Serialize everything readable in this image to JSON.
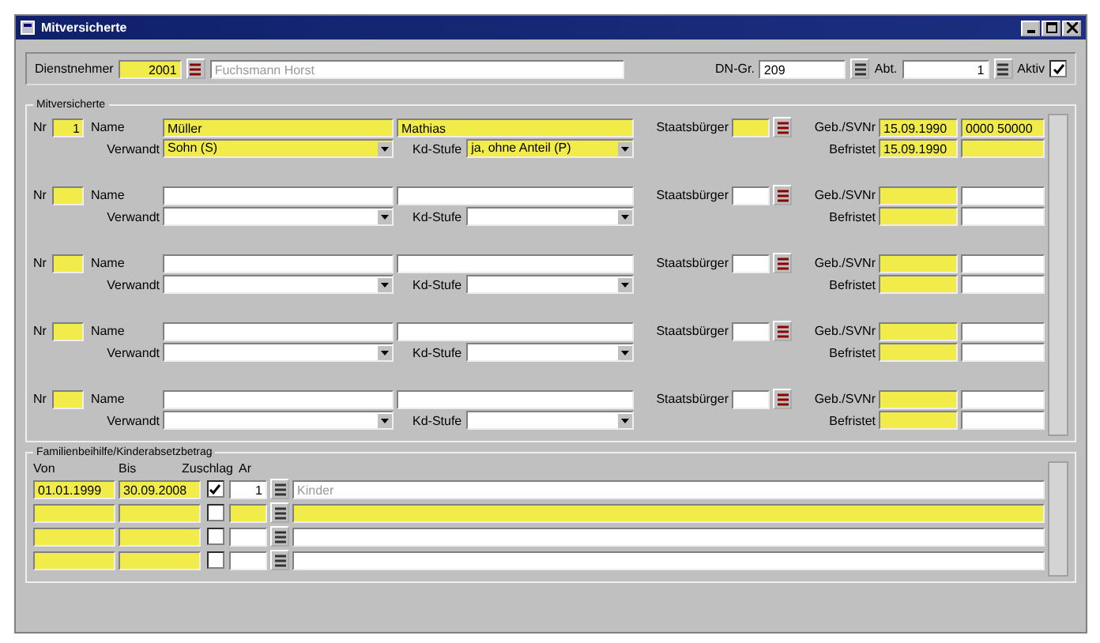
{
  "window": {
    "title": "Mitversicherte"
  },
  "header": {
    "employee_label": "Dienstnehmer",
    "employee_no": "2001",
    "employee_name": "Fuchsmann Horst",
    "group_label": "DN-Gr.",
    "group": "209",
    "dept_label": "Abt.",
    "dept": "1",
    "active_label": "Aktiv",
    "active": true
  },
  "insured": {
    "title": "Mitversicherte",
    "entries": [
      {
        "selected": true,
        "labels": {
          "nr": "Nr",
          "name": "Name",
          "relation": "Verwandt",
          "kd": "Kd-Stufe",
          "citizen": "Staatsbürger",
          "birth": "Geb./SVNr",
          "until": "Befristet"
        },
        "nr": "1",
        "surname": "Müller",
        "first_name": "Mathias",
        "relation": "Sohn (S)",
        "kd": "ja, ohne Anteil (P)",
        "birth": "15.09.1990",
        "sv": "0000 50000",
        "until": "15.09.1990"
      },
      {
        "selected": false,
        "labels": {
          "nr": "Nr",
          "name": "Name",
          "relation": "Verwandt",
          "kd": "Kd-Stufe",
          "citizen": "Staatsbürger",
          "birth": "Geb./SVNr",
          "until": "Befristet"
        }
      },
      {
        "selected": false,
        "labels": {
          "nr": "Nr",
          "name": "Name",
          "relation": "Verwandt",
          "kd": "Kd-Stufe",
          "citizen": "Staatsbürger",
          "birth": "Geb./SVNr",
          "until": "Befristet"
        }
      },
      {
        "selected": false,
        "labels": {
          "nr": "Nr",
          "name": "Name",
          "relation": "Verwandt",
          "kd": "Kd-Stufe",
          "citizen": "Staatsbürger",
          "birth": "Geb./SVNr",
          "until": "Befristet"
        }
      },
      {
        "selected": false,
        "labels": {
          "nr": "Nr",
          "name": "Name",
          "relation": "Verwandt",
          "kd": "Kd-Stufe",
          "citizen": "Staatsbürger",
          "birth": "Geb./SVNr",
          "until": "Befristet"
        }
      }
    ]
  },
  "family": {
    "title": "Familienbeihilfe/Kinderabsetzbetrag",
    "columns": [
      "Von",
      "Bis",
      "Zuschlag",
      "Ar"
    ],
    "rows": [
      {
        "from": "01.01.1999",
        "to": "30.09.2008",
        "checked": true,
        "count": "1",
        "note": "Kinder",
        "selected": false
      },
      {
        "checked": false,
        "selected": true
      },
      {
        "checked": false,
        "selected": false
      },
      {
        "checked": false,
        "selected": false
      }
    ]
  }
}
